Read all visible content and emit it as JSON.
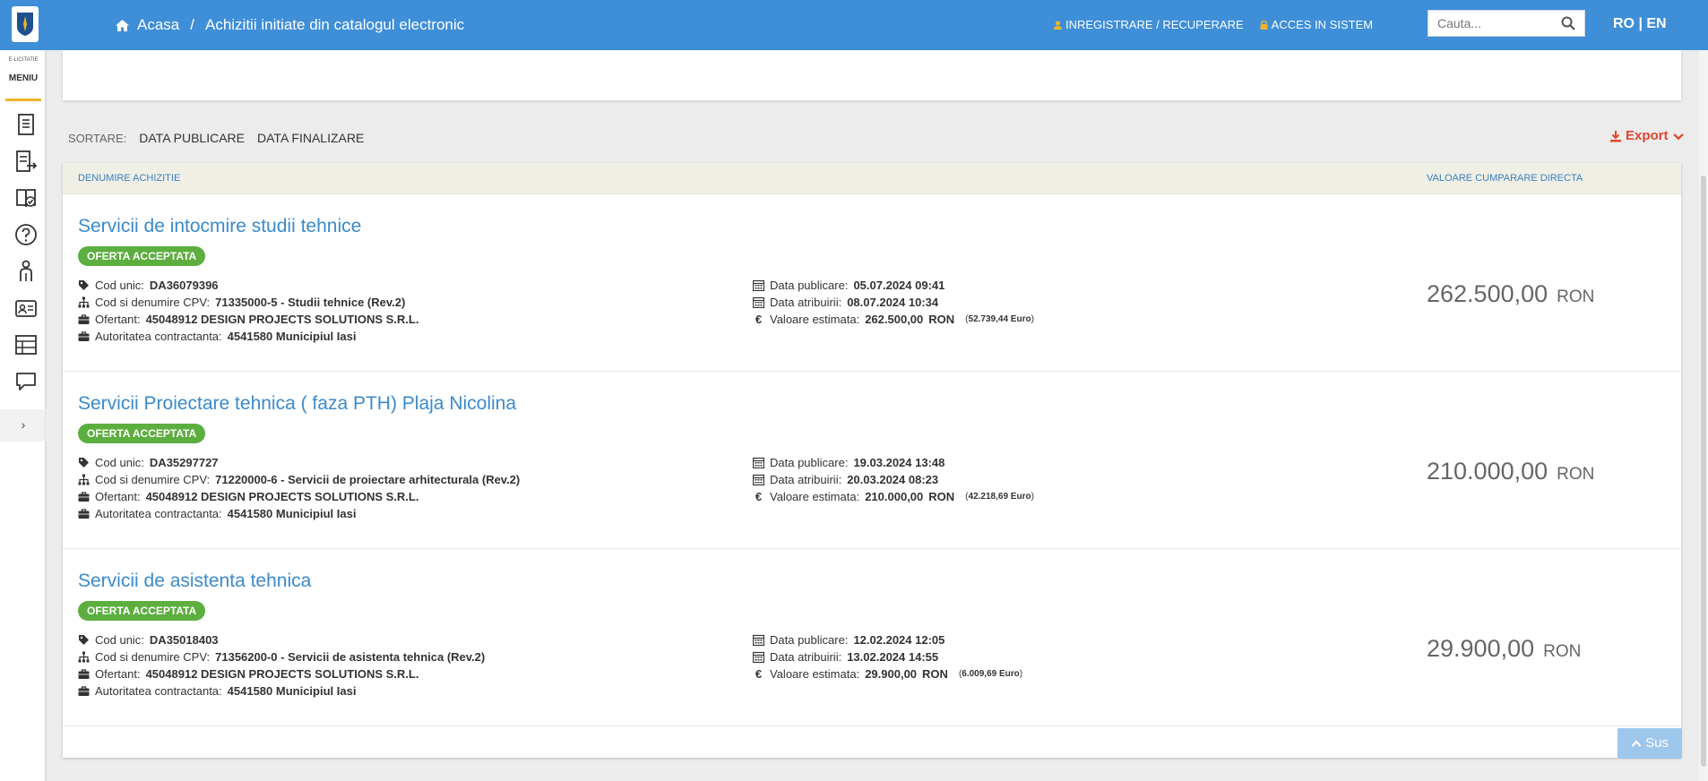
{
  "header": {
    "breadcrumb": [
      {
        "label": "Acasa"
      },
      {
        "label": "Achizitii initiate din catalogul electronic"
      }
    ],
    "breadcrumb_sep": "/",
    "links": [
      {
        "label": "INREGISTRARE / RECUPERARE"
      },
      {
        "label": "ACCES IN SISTEM"
      }
    ],
    "search_placeholder": "Cauta...",
    "lang": "RO | EN",
    "colors": {
      "bar": "#3e8ed8",
      "accent": "#f0b429"
    }
  },
  "sidebar": {
    "small_title": "E-LICITATIE",
    "menu_label": "MENIU",
    "icons": [
      "document-list-icon",
      "document-export-icon",
      "book-check-icon",
      "help-icon",
      "person-icon",
      "id-card-icon",
      "table-grid-icon",
      "chat-icon"
    ],
    "expand_label": "›"
  },
  "sort": {
    "label": "SORTARE:",
    "options": [
      "DATA PUBLICARE",
      "DATA FINALIZARE"
    ]
  },
  "export_label": "Export",
  "table": {
    "columns": [
      "DENUMIRE ACHIZITIE",
      "VALOARE CUMPARARE DIRECTA"
    ],
    "labels": {
      "cod": "Cod unic:",
      "cpv": "Cod si denumire CPV:",
      "ofertant": "Ofertant:",
      "autoritate": "Autoritatea contractanta:",
      "publicare": "Data publicare:",
      "atribuire": "Data atribuirii:",
      "estimata": "Valoare estimata:",
      "euro_sign": "€",
      "euro": "Euro"
    },
    "rows": [
      {
        "title": "Servicii de intocmire studii tehnice",
        "status": "OFERTA ACCEPTATA",
        "cod": "DA36079396",
        "cpv": "71335000-5 - Studii tehnice (Rev.2)",
        "ofertant": "45048912 DESIGN PROJECTS SOLUTIONS S.R.L.",
        "autoritate": "4541580 Municipiul Iasi",
        "publicare": "05.07.2024 09:41",
        "atribuire": "08.07.2024 10:34",
        "estimata": "262.500,00",
        "estimata_cur": "RON",
        "euro_val": "52.739,44",
        "price": "262.500,00",
        "price_cur": "RON"
      },
      {
        "title": "Servicii Proiectare tehnica ( faza PTH) Plaja Nicolina",
        "status": "OFERTA ACCEPTATA",
        "cod": "DA35297727",
        "cpv": "71220000-6 - Servicii de proiectare arhitecturala (Rev.2)",
        "ofertant": "45048912 DESIGN PROJECTS SOLUTIONS S.R.L.",
        "autoritate": "4541580 Municipiul Iasi",
        "publicare": "19.03.2024 13:48",
        "atribuire": "20.03.2024 08:23",
        "estimata": "210.000,00",
        "estimata_cur": "RON",
        "euro_val": "42.218,69",
        "price": "210.000,00",
        "price_cur": "RON"
      },
      {
        "title": "Servicii de asistenta tehnica",
        "status": "OFERTA ACCEPTATA",
        "cod": "DA35018403",
        "cpv": "71356200-0 - Servicii de asistenta tehnica (Rev.2)",
        "ofertant": "45048912 DESIGN PROJECTS SOLUTIONS S.R.L.",
        "autoritate": "4541580 Municipiul Iasi",
        "publicare": "12.02.2024 12:05",
        "atribuire": "13.02.2024 14:55",
        "estimata": "29.900,00",
        "estimata_cur": "RON",
        "euro_val": "6.009,69",
        "price": "29.900,00",
        "price_cur": "RON"
      }
    ],
    "colors": {
      "badge": "#5cae3f",
      "title": "#3a8acb",
      "header_bg": "#f0efe6"
    }
  },
  "scroll_top_label": "Sus"
}
